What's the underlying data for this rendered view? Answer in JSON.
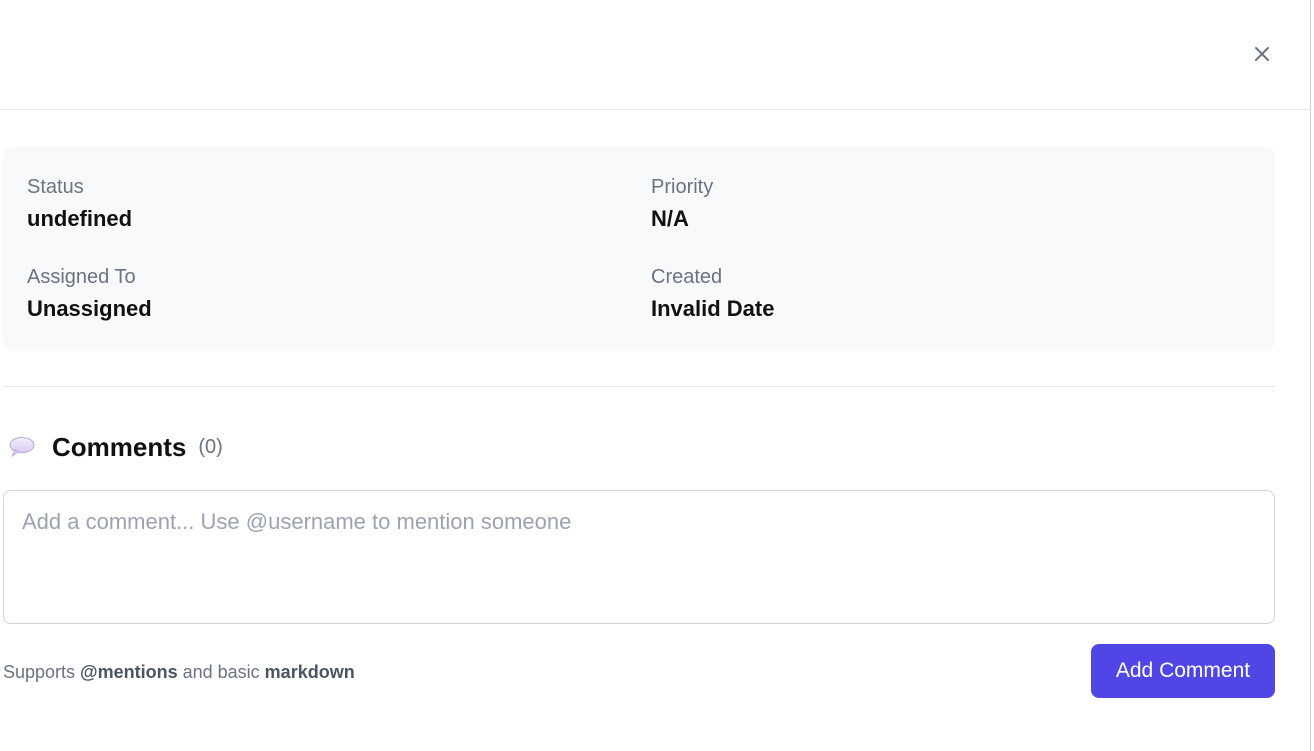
{
  "header": {
    "close_icon": "close-icon"
  },
  "details": {
    "status": {
      "label": "Status",
      "value": "undefined"
    },
    "priority": {
      "label": "Priority",
      "value": "N/A"
    },
    "assigned_to": {
      "label": "Assigned To",
      "value": "Unassigned"
    },
    "created": {
      "label": "Created",
      "value": "Invalid Date"
    }
  },
  "comments": {
    "icon": "speech-bubble-icon",
    "title": "Comments",
    "count": "(0)",
    "input_placeholder": "Add a comment... Use @username to mention someone",
    "input_value": "",
    "hint_prefix": "Supports ",
    "hint_mentions": "@mentions",
    "hint_middle": " and basic ",
    "hint_markdown": "markdown",
    "submit_label": "Add Comment"
  },
  "colors": {
    "accent": "#4f46e5",
    "card_background": "#f8f9fb",
    "muted_text": "#6b7280"
  }
}
